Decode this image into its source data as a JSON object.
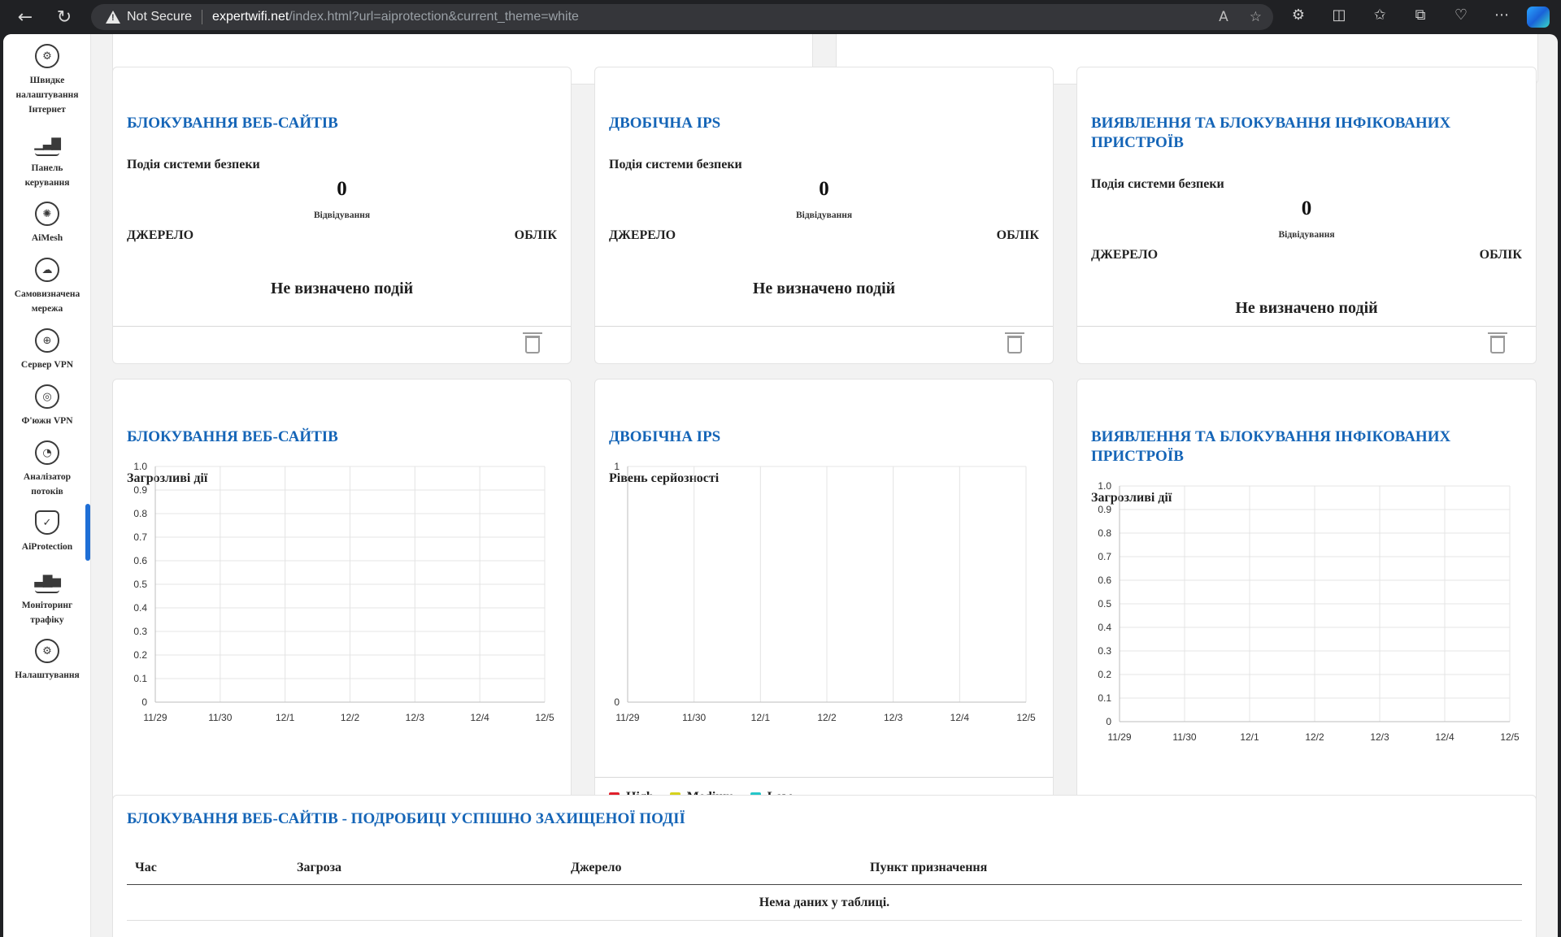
{
  "browser": {
    "back_icon": "back-arrow-icon",
    "reload_icon": "reload-icon",
    "security_label": "Not Secure",
    "url_host": "expertwifi.net",
    "url_rest": "/index.html?url=aiprotection&current_theme=white"
  },
  "sidebar": {
    "items": [
      {
        "label": "Швидке\nналаштування\nІнтернет",
        "icon": "globe-gear-icon"
      },
      {
        "label": "Панель\nкерування",
        "icon": "dashboard-bars-icon"
      },
      {
        "label": "AiMesh",
        "icon": "mesh-icon"
      },
      {
        "label": "Самовизначена\nмережа",
        "icon": "custom-network-icon"
      },
      {
        "label": "Сервер VPN",
        "icon": "vpn-server-icon"
      },
      {
        "label": "Ф'южн VPN",
        "icon": "fusion-vpn-icon"
      },
      {
        "label": "Аналізатор\nпотоків",
        "icon": "flow-analyzer-icon"
      },
      {
        "label": "AiProtection",
        "icon": "shield-icon"
      },
      {
        "label": "Моніторинг\nтрафіку",
        "icon": "traffic-bars-icon"
      },
      {
        "label": "Налаштування",
        "icon": "settings-gear-icon"
      }
    ],
    "active": "AiProtection"
  },
  "summary_cards": [
    {
      "title": "БЛОКУВАННЯ ВЕБ-САЙТІВ",
      "section": "Подія системи безпеки",
      "count": "0",
      "count_label": "Відвідування",
      "col_source": "ДЖЕРЕЛО",
      "col_account": "ОБЛІК",
      "empty": "Не визначено подій"
    },
    {
      "title": "ДВОБІЧНА IPS",
      "section": "Подія системи безпеки",
      "count": "0",
      "count_label": "Відвідування",
      "col_source": "ДЖЕРЕЛО",
      "col_account": "ОБЛІК",
      "empty": "Не визначено подій"
    },
    {
      "title": "ВИЯВЛЕННЯ ТА БЛОКУВАННЯ ІНФІКОВАНИХ ПРИСТРОЇВ",
      "section": "Подія системи безпеки",
      "count": "0",
      "count_label": "Відвідування",
      "col_source": "ДЖЕРЕЛО",
      "col_account": "ОБЛІК",
      "empty": "Не визначено подій"
    }
  ],
  "chart_cards": [
    {
      "title": "БЛОКУВАННЯ ВЕБ-САЙТІВ",
      "subtitle": "Загрозливі дії"
    },
    {
      "title": "ДВОБІЧНА IPS",
      "subtitle": "Рівень серйозності"
    },
    {
      "title": "ВИЯВЛЕННЯ ТА БЛОКУВАННЯ ІНФІКОВАНИХ ПРИСТРОЇВ",
      "subtitle": "Загрозливі дії"
    }
  ],
  "chart_data": [
    {
      "type": "line",
      "title": "Загрозливі дії",
      "categories": [
        "11/29",
        "11/30",
        "12/1",
        "12/2",
        "12/3",
        "12/4",
        "12/5"
      ],
      "series": [],
      "ylim": [
        0,
        1.0
      ],
      "yticks": [
        "0",
        "0.1",
        "0.2",
        "0.3",
        "0.4",
        "0.5",
        "0.6",
        "0.7",
        "0.8",
        "0.9",
        "1.0"
      ],
      "grid": true
    },
    {
      "type": "line",
      "title": "Рівень серйозності",
      "categories": [
        "11/29",
        "11/30",
        "12/1",
        "12/2",
        "12/3",
        "12/4",
        "12/5"
      ],
      "series": [],
      "ylim": [
        0,
        1
      ],
      "yticks": [
        "0",
        "1"
      ],
      "grid": true,
      "legend": [
        {
          "name": "High",
          "color": "#e0202b"
        },
        {
          "name": "Medium",
          "color": "#d6d21d"
        },
        {
          "name": "Low",
          "color": "#25c6c9"
        }
      ],
      "legend_position": "bottom-left"
    },
    {
      "type": "line",
      "title": "Загрозливі дії",
      "categories": [
        "11/29",
        "11/30",
        "12/1",
        "12/2",
        "12/3",
        "12/4",
        "12/5"
      ],
      "series": [],
      "ylim": [
        0,
        1.0
      ],
      "yticks": [
        "0",
        "0.1",
        "0.2",
        "0.3",
        "0.4",
        "0.5",
        "0.6",
        "0.7",
        "0.8",
        "0.9",
        "1.0"
      ],
      "grid": true
    }
  ],
  "details": {
    "title": "БЛОКУВАННЯ ВЕБ-САЙТІВ - ПОДРОБИЦІ УСПІШНО ЗАХИЩЕНОЇ ПОДІЇ",
    "columns": [
      "Час",
      "Загроза",
      "Джерело",
      "Пункт призначення"
    ],
    "empty": "Нема даних у таблиці."
  }
}
